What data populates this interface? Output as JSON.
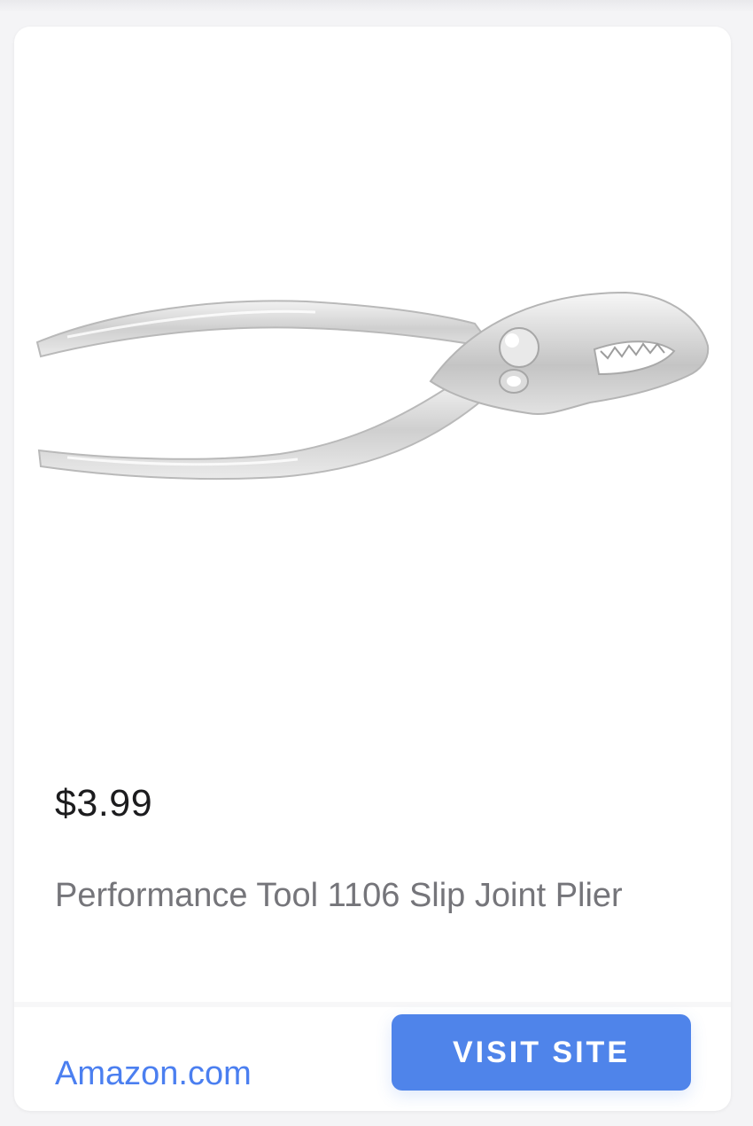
{
  "product": {
    "image_alt": "pliers-image",
    "price": "$3.99",
    "title": "Performance Tool 1106 Slip Joint Plier"
  },
  "footer": {
    "merchant": "Amazon.com",
    "button_label": "VISIT SITE"
  },
  "colors": {
    "accent": "#4F84EA",
    "link": "#4B7FF0",
    "price_text": "#1C1C1E",
    "title_text": "#75757A"
  }
}
